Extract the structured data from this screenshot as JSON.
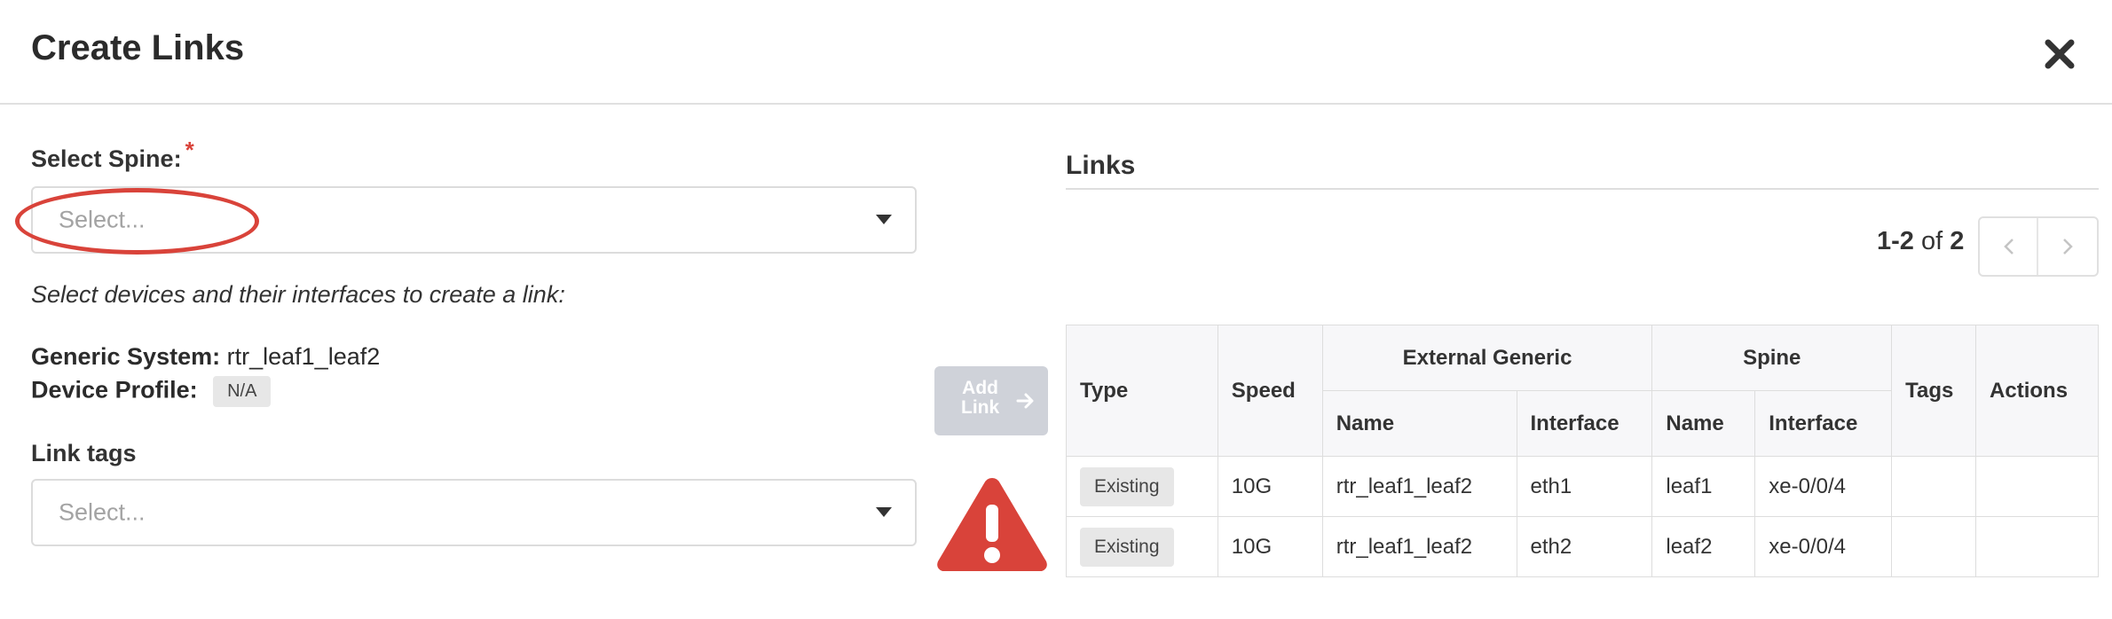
{
  "dialog": {
    "title": "Create Links",
    "close_icon": "close-icon"
  },
  "form": {
    "spine_label": "Select Spine:",
    "required_marker": "*",
    "spine_placeholder": "Select...",
    "hint": "Select devices and their interfaces to create a link:",
    "generic_system_label": "Generic System:",
    "generic_system_value": "rtr_leaf1_leaf2",
    "device_profile_label": "Device Profile:",
    "device_profile_value": "N/A",
    "link_tags_label": "Link tags",
    "link_tags_placeholder": "Select..."
  },
  "actions": {
    "add_link_line1": "Add",
    "add_link_line2": "Link",
    "warning_icon": "warning-triangle-icon"
  },
  "links": {
    "title": "Links",
    "pager": {
      "range": "1-2",
      "of_label": "of",
      "total": "2"
    },
    "columns": {
      "type": "Type",
      "speed": "Speed",
      "external_generic": "External Generic",
      "spine": "Spine",
      "tags": "Tags",
      "actions": "Actions",
      "name": "Name",
      "interface": "Interface"
    },
    "rows": [
      {
        "type": "Existing",
        "speed": "10G",
        "ext_name": "rtr_leaf1_leaf2",
        "ext_interface": "eth1",
        "spine_name": "leaf1",
        "spine_interface": "xe-0/0/4",
        "tags": "",
        "actions": ""
      },
      {
        "type": "Existing",
        "speed": "10G",
        "ext_name": "rtr_leaf1_leaf2",
        "ext_interface": "eth2",
        "spine_name": "leaf2",
        "spine_interface": "xe-0/0/4",
        "tags": "",
        "actions": ""
      }
    ]
  },
  "colors": {
    "accent_red": "#d9433a",
    "button_disabled": "#cfd2d9"
  }
}
